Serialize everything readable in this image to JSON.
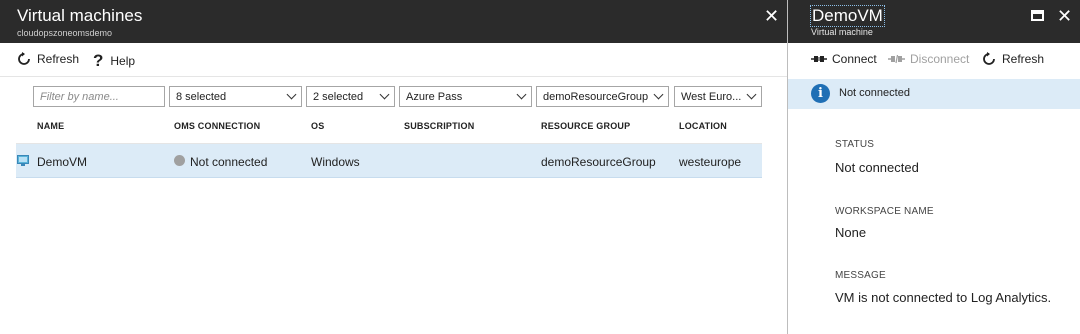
{
  "left_blade": {
    "title": "Virtual machines",
    "subtitle": "cloudopszoneomsdemo",
    "commands": {
      "refresh": "Refresh",
      "help": "Help"
    },
    "filters": {
      "name_placeholder": "Filter by name...",
      "oms_connection": "8 selected",
      "os": "2 selected",
      "subscription": "Azure Pass",
      "resource_group": "demoResourceGroup",
      "location": "West Euro..."
    },
    "columns": [
      "NAME",
      "OMS CONNECTION",
      "OS",
      "SUBSCRIPTION",
      "RESOURCE GROUP",
      "LOCATION"
    ],
    "rows": [
      {
        "name": "DemoVM",
        "oms_connection": "Not connected",
        "os": "Windows",
        "subscription": "",
        "resource_group": "demoResourceGroup",
        "location": "westeurope"
      }
    ]
  },
  "right_blade": {
    "title": "DemoVM",
    "subtitle": "Virtual machine",
    "commands": {
      "connect": "Connect",
      "disconnect": "Disconnect",
      "refresh": "Refresh"
    },
    "info_message": "Not connected",
    "fields": [
      {
        "label": "STATUS",
        "value": "Not connected"
      },
      {
        "label": "WORKSPACE NAME",
        "value": "None"
      },
      {
        "label": "MESSAGE",
        "value": "VM is not connected to Log Analytics."
      }
    ]
  },
  "icons": {
    "close": "close-icon",
    "refresh": "refresh-icon",
    "help": "help-icon",
    "vm": "vm-icon",
    "connect": "connect-icon",
    "disconnect": "disconnect-icon",
    "info": "info-icon",
    "maximize": "maximize-icon",
    "chevron": "chevron-down-icon"
  },
  "colors": {
    "header_bg": "#2b2b2b",
    "selected_row": "#dcebf7",
    "info_blue": "#1f6fb5",
    "status_gray": "#a0a0a0"
  }
}
